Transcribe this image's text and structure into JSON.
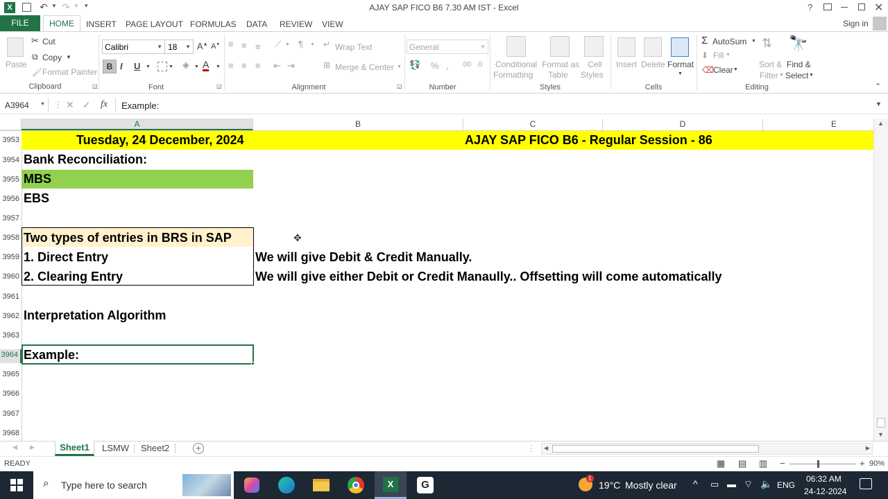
{
  "window": {
    "title": "AJAY SAP FICO B6 7.30 AM IST - Excel",
    "help": "?",
    "sign_in": "Sign in"
  },
  "tabs": [
    "FILE",
    "HOME",
    "INSERT",
    "PAGE LAYOUT",
    "FORMULAS",
    "DATA",
    "REVIEW",
    "VIEW"
  ],
  "ribbon": {
    "clipboard": {
      "paste": "Paste",
      "cut": "Cut",
      "copy": "Copy",
      "format_painter": "Format Painter",
      "label": "Clipboard"
    },
    "font": {
      "name": "Calibri",
      "size": "18",
      "label": "Font"
    },
    "alignment": {
      "wrap_text": "Wrap Text",
      "merge_center": "Merge & Center",
      "label": "Alignment"
    },
    "number": {
      "format": "General",
      "label": "Number"
    },
    "styles": {
      "conditional": "Conditional",
      "formatting": "Formatting",
      "format_as": "Format as",
      "table": "Table",
      "cell": "Cell",
      "styles_word": "Styles",
      "label": "Styles"
    },
    "cells": {
      "insert": "Insert",
      "delete": "Delete",
      "format": "Format",
      "label": "Cells"
    },
    "editing": {
      "autosum": "AutoSum",
      "fill": "Fill",
      "clear": "Clear",
      "sort": "Sort &",
      "filter": "Filter",
      "find": "Find &",
      "select": "Select",
      "label": "Editing"
    }
  },
  "formula_bar": {
    "name_box": "A3964",
    "content": "Example:"
  },
  "columns": [
    "A",
    "B",
    "C",
    "D",
    "E"
  ],
  "rows": [
    "3953",
    "3954",
    "3955",
    "3956",
    "3957",
    "3958",
    "3959",
    "3960",
    "3961",
    "3962",
    "3963",
    "3964",
    "3965",
    "3966",
    "3967",
    "3968"
  ],
  "cells": {
    "a3953": "Tuesday, 24 December, 2024",
    "c3953": "AJAY SAP FICO B6 - Regular Session - 86",
    "a3954": "Bank Reconciliation:",
    "a3955": "MBS",
    "a3956": "EBS",
    "a3958": "Two types of entries in BRS in SAP",
    "a3959": "1. Direct Entry",
    "b3959": "We will give Debit & Credit Manually.",
    "a3960": "2. Clearing Entry",
    "b3960": "We will give either Debit or Credit Manaully.. Offsetting will come automatically",
    "a3962": "Interpretation Algorithm",
    "a3964": "Example:"
  },
  "sheets": [
    "Sheet1",
    "LSMW",
    "Sheet2"
  ],
  "status": {
    "ready": "READY",
    "zoom": "90%"
  },
  "taskbar": {
    "search_placeholder": "Type here to search",
    "weather_temp": "19°C",
    "weather_text": "Mostly clear",
    "weather_badge": "1",
    "lang": "ENG",
    "time": "06:32 AM",
    "date": "24-12-2024"
  },
  "colors": {
    "excel_green": "#217346",
    "yellow": "#ffff00",
    "green_fill": "#92d050",
    "cream_fill": "#fff2cc"
  }
}
